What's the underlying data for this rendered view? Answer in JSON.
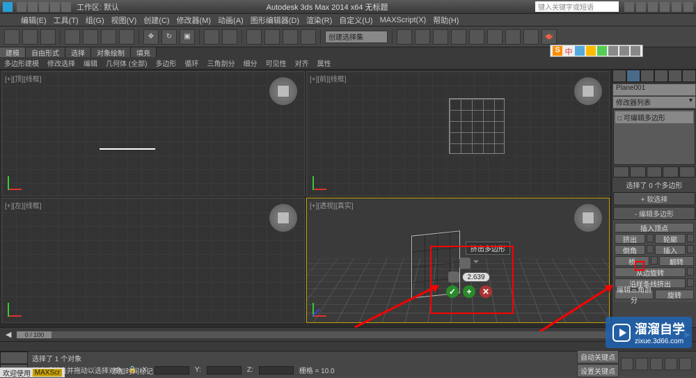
{
  "titlebar": {
    "workspace_label": "工作区: 默认",
    "title": "Autodesk 3ds Max  2014 x64   无标题",
    "search_placeholder": "键入关键字或短语"
  },
  "menus": [
    "编辑(E)",
    "工具(T)",
    "组(G)",
    "视图(V)",
    "创建(C)",
    "修改器(M)",
    "动画(A)",
    "图形编辑器(D)",
    "渲染(R)",
    "自定义(U)",
    "MAXScript(X)",
    "帮助(H)"
  ],
  "toolbar": {
    "dropdown": "创建选择集"
  },
  "ribbon": {
    "tabs": [
      "建模",
      "自由形式",
      "选择",
      "对象绘制",
      "填充"
    ],
    "subtabs": [
      "多边形建模",
      "修改选择",
      "编辑",
      "几何体 (全部)",
      "多边形",
      "循环",
      "三角剖分",
      "细分",
      "可见性",
      "对齐",
      "属性"
    ]
  },
  "ime": {
    "letter": "S",
    "zhong": "中"
  },
  "viewports": {
    "vp1": "[+][顶][线框]",
    "vp2": "[+][前][线框]",
    "vp3": "[+][左][线框]",
    "vp4": "[+][透视][真实]"
  },
  "caddy": {
    "tooltip": "挤出多边形",
    "value": "2.639"
  },
  "panel": {
    "object_name": "Plane001",
    "dropdown": "修改器列表",
    "stack_item": "可编辑多边形",
    "selection_text": "选择了 0 个多边形",
    "sections": {
      "soft": "软选择",
      "edit_poly": "编辑多边形",
      "insert_vertex": "插入顶点",
      "extrude": "挤出",
      "outline": "轮廓",
      "bevel": "倒角",
      "inset": "插入",
      "bridge": "桥",
      "flip": "翻转",
      "hinge": "从边旋转",
      "extrude_spline": "沿样条线挤出",
      "edit_tri": "编辑三角剖分",
      "retri": "旋转"
    }
  },
  "timeline": {
    "thumb": "0 / 100"
  },
  "status": {
    "selected": "选择了 1 个对象",
    "hint": "单击或单击并拖动以选择对象",
    "grid": "栅格 = 10.0",
    "add_time_tag": "添加时间标记",
    "auto_key": "自动关键点",
    "set_key": "设置关键点",
    "welcome": "欢迎使用",
    "maxscr": "MAXScr"
  },
  "watermark": {
    "text": "溜溜自学",
    "url": "zixue.3d66.com"
  }
}
